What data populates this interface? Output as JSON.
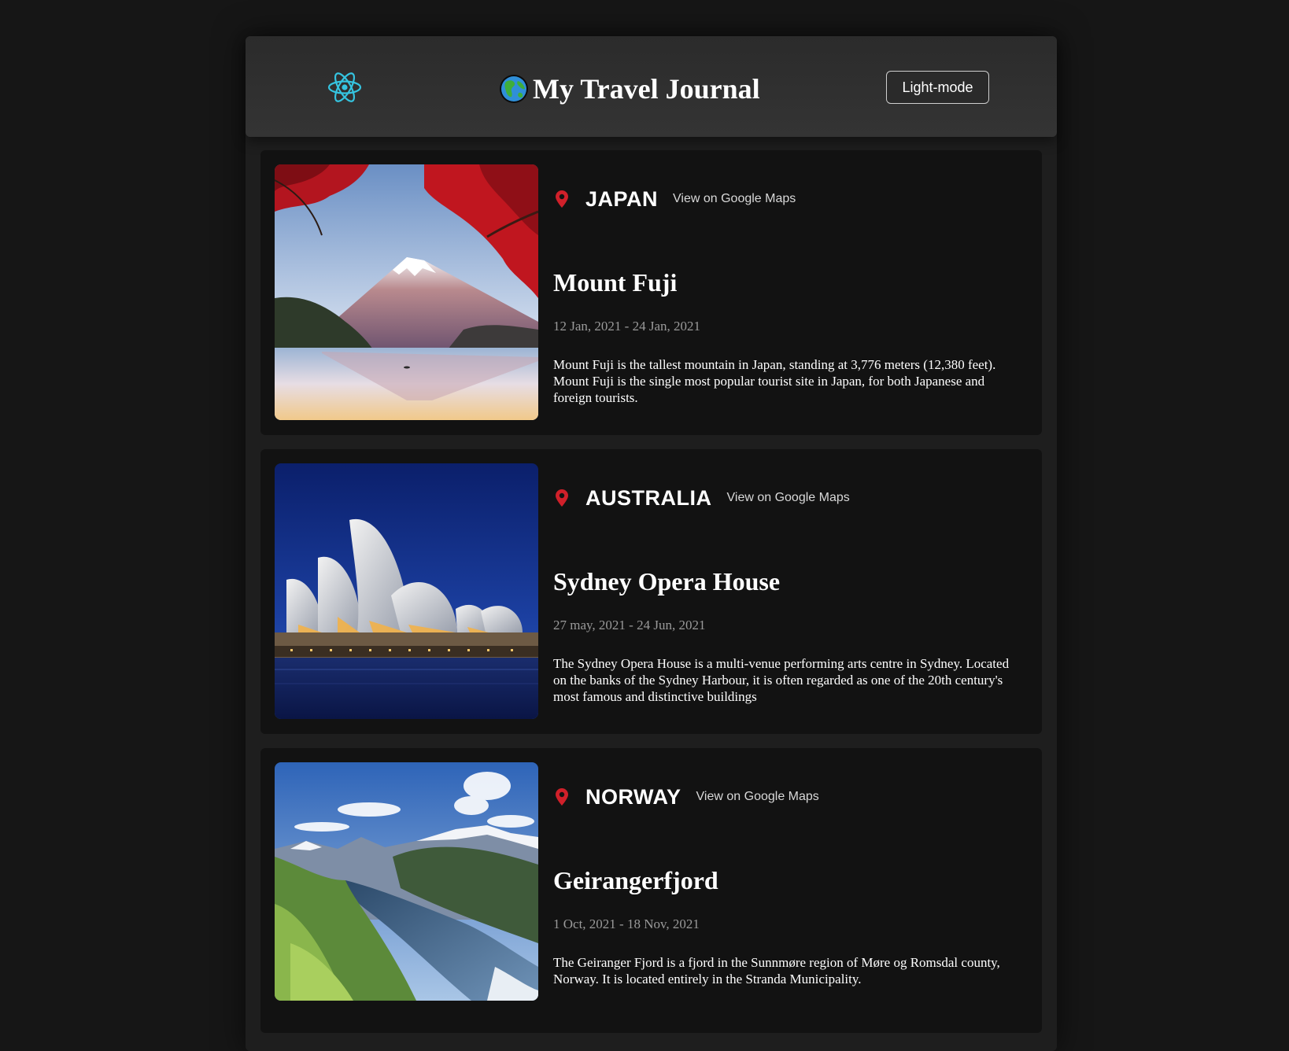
{
  "header": {
    "logo_icon": "react-atom-icon",
    "globe_icon": "globe-icon",
    "title": "My Travel Journal",
    "mode_button_label": "Light-mode"
  },
  "colors": {
    "background": "#161616",
    "card_background": "#121212",
    "header_background": "#303030",
    "react_logo": "#35c4e0",
    "pin": "#d0202a"
  },
  "entries": [
    {
      "country": "JAPAN",
      "maps_link": "View on Google Maps",
      "title": "Mount Fuji",
      "dates": "12 Jan, 2021 - 24 Jan, 2021",
      "description": "Mount Fuji is the tallest mountain in Japan, standing at 3,776 meters (12,380 feet). Mount Fuji is the single most popular tourist site in Japan, for both Japanese and foreign tourists.",
      "image": "mount-fuji-photo"
    },
    {
      "country": "AUSTRALIA",
      "maps_link": "View on Google Maps",
      "title": "Sydney Opera House",
      "dates": "27 may, 2021 - 24 Jun, 2021",
      "description": "The Sydney Opera House is a multi-venue performing arts centre in Sydney. Located on the banks of the Sydney Harbour, it is often regarded as one of the 20th century's most famous and distinctive buildings",
      "image": "sydney-opera-house-photo"
    },
    {
      "country": "NORWAY",
      "maps_link": "View on Google Maps",
      "title": "Geirangerfjord",
      "dates": "1 Oct, 2021 - 18 Nov, 2021",
      "description": "The Geiranger Fjord is a fjord in the Sunnmøre region of Møre og Romsdal county, Norway. It is located entirely in the Stranda Municipality.",
      "image": "geirangerfjord-photo"
    }
  ]
}
